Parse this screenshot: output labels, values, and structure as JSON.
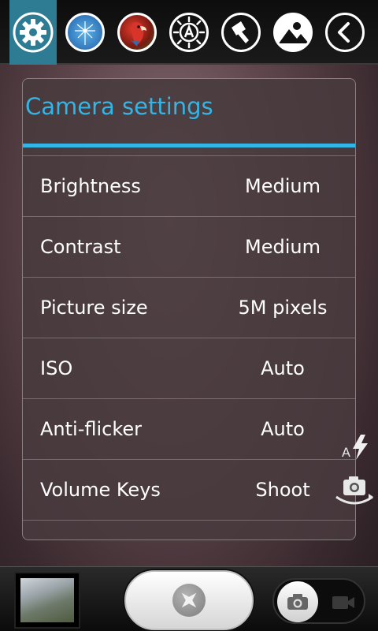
{
  "toolbar": {
    "items": [
      {
        "name": "settings",
        "active": true
      },
      {
        "name": "color-effect"
      },
      {
        "name": "scene-mode"
      },
      {
        "name": "white-balance"
      },
      {
        "name": "flash-mode"
      },
      {
        "name": "image-settings"
      },
      {
        "name": "back"
      }
    ]
  },
  "panel": {
    "title": "Camera settings",
    "rows": [
      {
        "label": "Brightness",
        "value": "Medium"
      },
      {
        "label": "Contrast",
        "value": "Medium"
      },
      {
        "label": "Picture size",
        "value": "5M pixels"
      },
      {
        "label": "ISO",
        "value": "Auto"
      },
      {
        "label": "Anti-flicker",
        "value": "Auto"
      },
      {
        "label": "Volume Keys",
        "value": "Shoot"
      }
    ]
  },
  "side": {
    "flash_label": "A"
  },
  "colors": {
    "accent": "#33b5e5",
    "active_tab": "#2d7c93"
  }
}
